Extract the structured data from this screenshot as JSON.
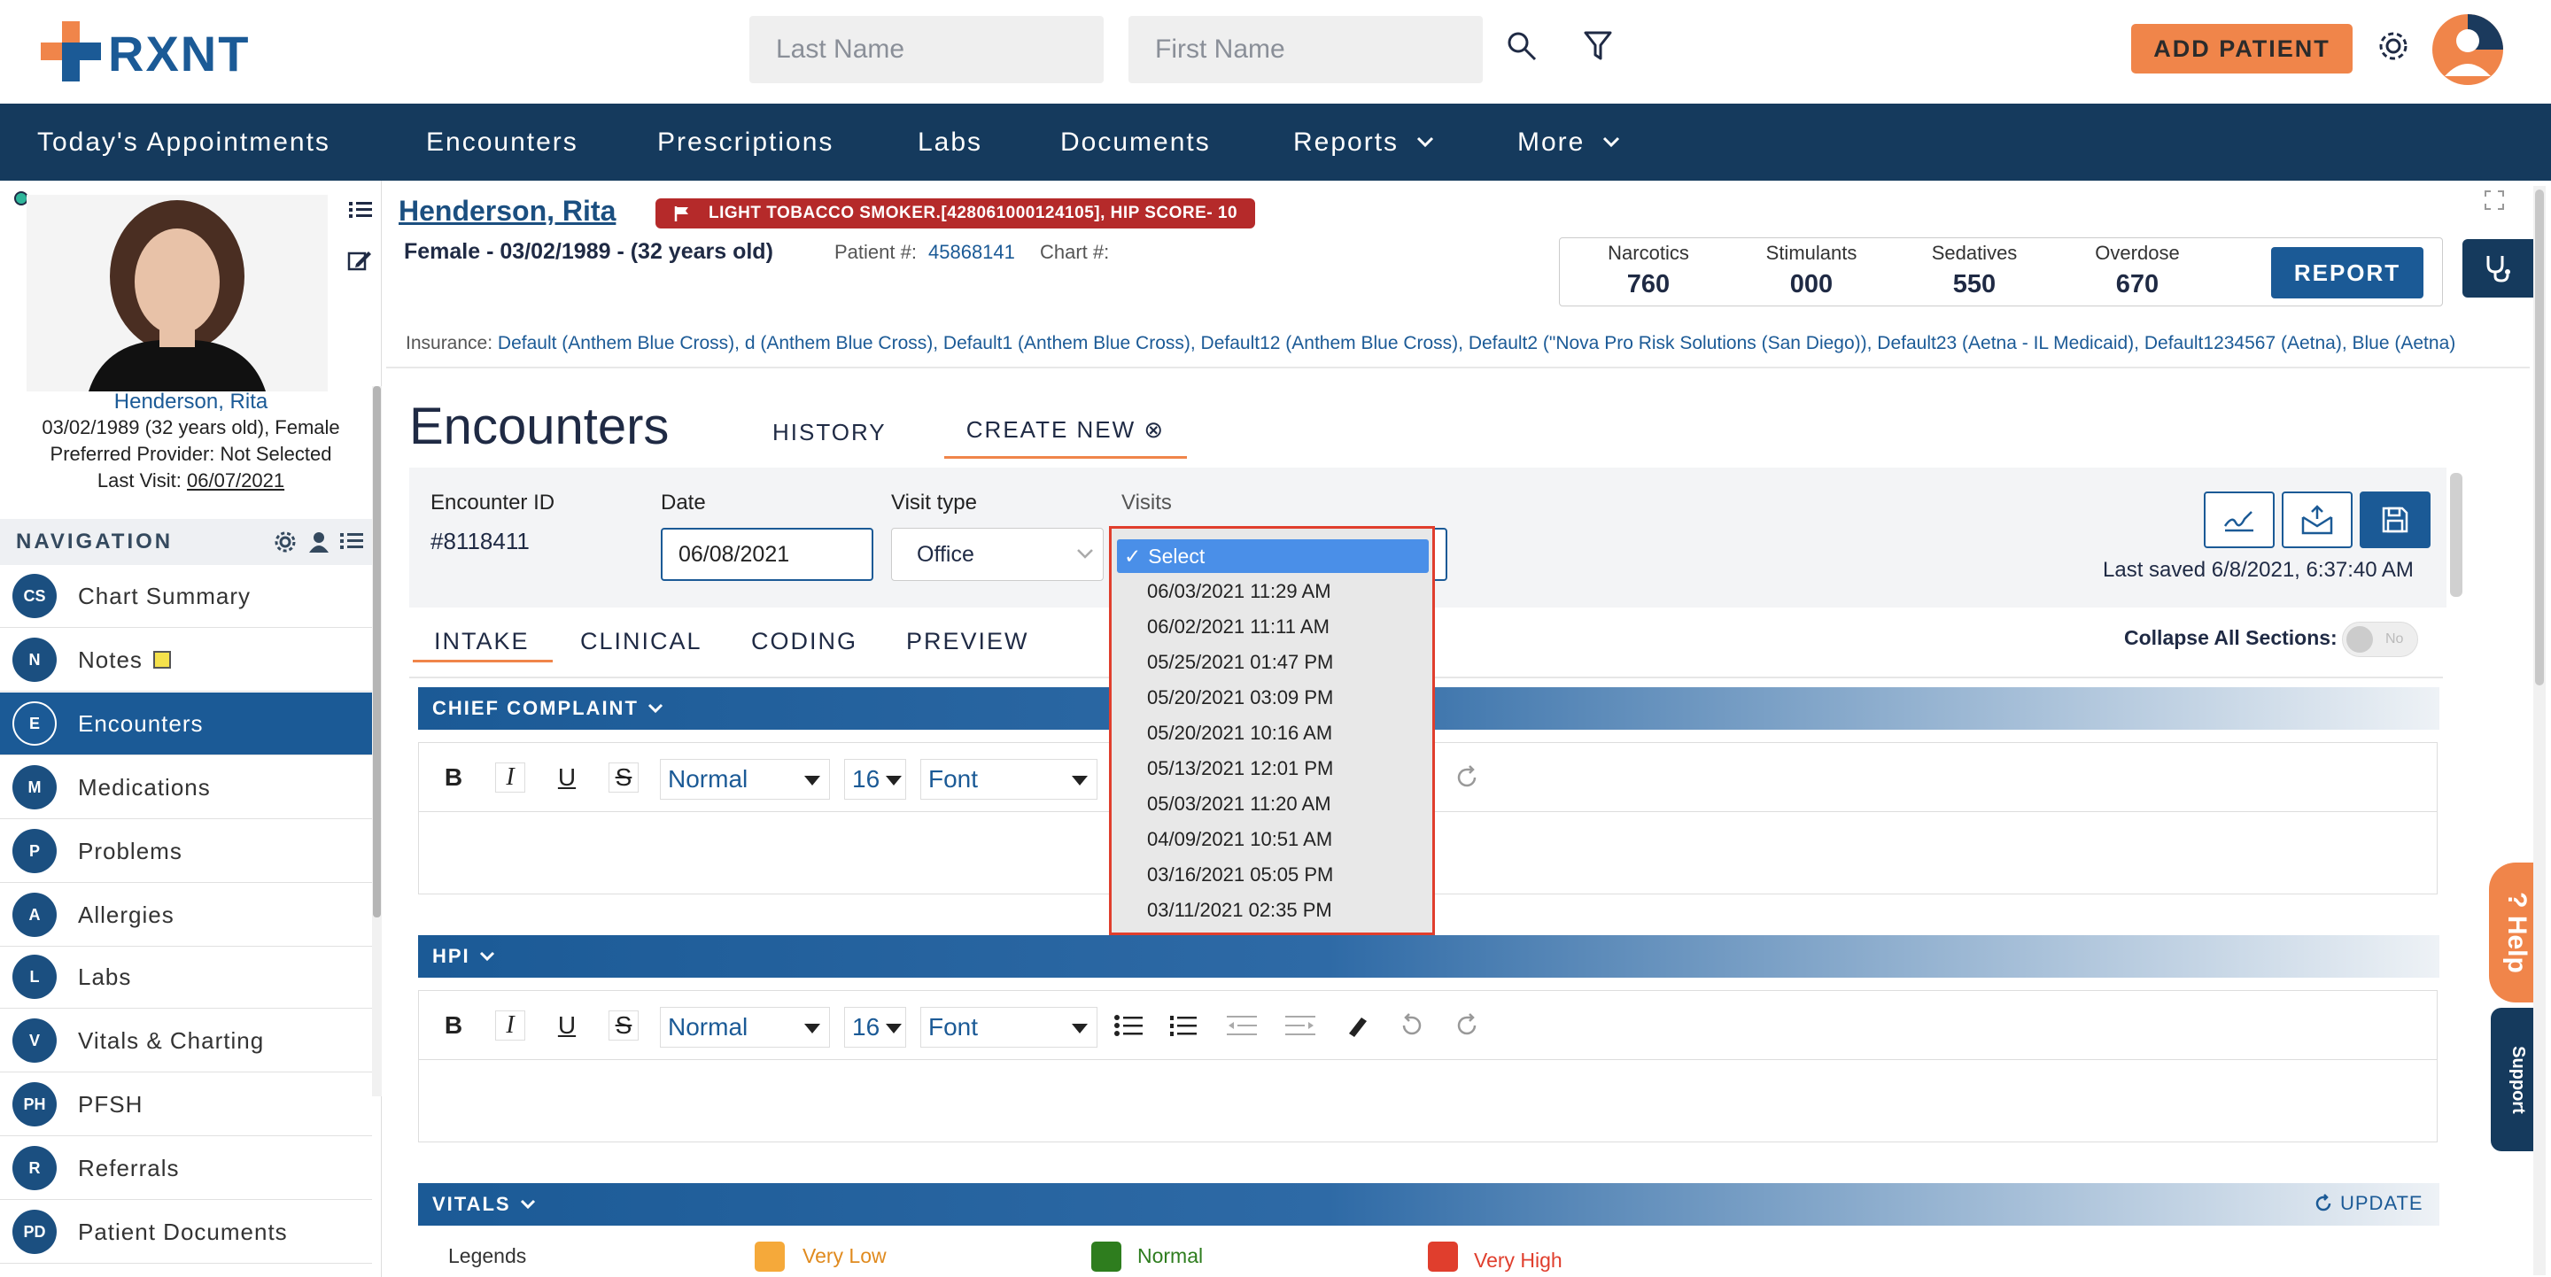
{
  "header": {
    "brand": "RXNT",
    "last_name_placeholder": "Last Name",
    "first_name_placeholder": "First Name",
    "add_patient": "ADD PATIENT"
  },
  "nav": [
    "Today's Appointments",
    "Encounters",
    "Prescriptions",
    "Labs",
    "Documents",
    "Reports",
    "More"
  ],
  "patient": {
    "name": "Henderson, Rita",
    "dob_line": "03/02/1989 (32 years old), Female",
    "provider_line": "Preferred Provider: Not Selected",
    "last_visit_label": "Last Visit:",
    "last_visit": "06/07/2021",
    "flag": "LIGHT TOBACCO SMOKER.[428061000124105], HIP SCORE- 10",
    "summary": "Female - 03/02/1989 - (32 years old)",
    "patient_num_label": "Patient #:",
    "patient_num": "45868141",
    "chart_label": "Chart #:",
    "insurance_label": "Insurance:",
    "insurance": "Default (Anthem Blue Cross), d (Anthem Blue Cross), Default1 (Anthem Blue Cross), Default12 (Anthem Blue Cross), Default2 (\"Nova Pro Risk Solutions (San Diego)), Default23 (Aetna - IL Medicaid), Default1234567 (Aetna), Blue (Aetna)"
  },
  "pdmp": {
    "narcotics_label": "Narcotics",
    "narcotics": "760",
    "stimulants_label": "Stimulants",
    "stimulants": "000",
    "sedatives_label": "Sedatives",
    "sedatives": "550",
    "overdose_label": "Overdose",
    "overdose": "670",
    "report": "REPORT"
  },
  "left_nav": {
    "title": "NAVIGATION",
    "items": [
      {
        "code": "CS",
        "label": "Chart Summary"
      },
      {
        "code": "N",
        "label": "Notes"
      },
      {
        "code": "E",
        "label": "Encounters"
      },
      {
        "code": "M",
        "label": "Medications"
      },
      {
        "code": "P",
        "label": "Problems"
      },
      {
        "code": "A",
        "label": "Allergies"
      },
      {
        "code": "L",
        "label": "Labs"
      },
      {
        "code": "V",
        "label": "Vitals & Charting"
      },
      {
        "code": "PH",
        "label": "PFSH"
      },
      {
        "code": "R",
        "label": "Referrals"
      },
      {
        "code": "PD",
        "label": "Patient Documents"
      }
    ]
  },
  "encounter": {
    "title": "Encounters",
    "tab_history": "HISTORY",
    "tab_create": "CREATE NEW ⊗",
    "id_label": "Encounter ID",
    "id": "#8118411",
    "date_label": "Date",
    "date": "06/08/2021",
    "visit_type_label": "Visit type",
    "visit_type": "Office",
    "visits_label": "Visits",
    "last_saved": "Last saved 6/8/2021, 6:37:40 AM",
    "subtabs": [
      "INTAKE",
      "CLINICAL",
      "CODING",
      "PREVIEW"
    ],
    "collapse_label": "Collapse All Sections:",
    "collapse_state": "No"
  },
  "sections": {
    "chief": "CHIEF COMPLAINT",
    "hpi": "HPI",
    "vitals": "VITALS",
    "update": "UPDATE"
  },
  "editor": {
    "format": "Normal",
    "size": "16",
    "font": "Font"
  },
  "visits_dropdown": {
    "selected": "Select",
    "options": [
      "06/03/2021 11:29 AM",
      "06/02/2021 11:11 AM",
      "05/25/2021 01:47 PM",
      "05/20/2021 03:09 PM",
      "05/20/2021 10:16 AM",
      "05/13/2021 12:01 PM",
      "05/03/2021 11:20 AM",
      "04/09/2021 10:51 AM",
      "03/16/2021 05:05 PM",
      "03/11/2021 02:35 PM"
    ]
  },
  "legends": {
    "label": "Legends",
    "very_low": "Very Low",
    "normal": "Normal",
    "very_high": "Very High"
  },
  "widgets": {
    "help": "? Help",
    "support": "Support"
  },
  "colors": {
    "primary": "#1b5a96",
    "navy": "#153a5d",
    "accent": "#f0854a",
    "flag": "#b52a2a"
  }
}
